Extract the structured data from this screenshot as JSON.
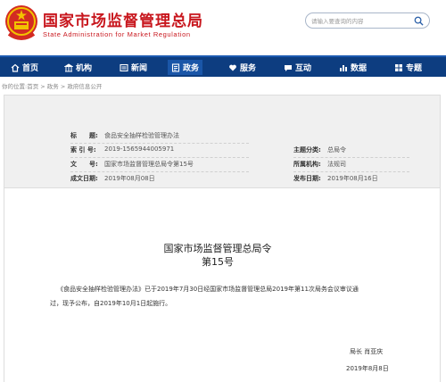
{
  "header": {
    "title": "国家市场监督管理总局",
    "subtitle": "State Administration for Market Regulation",
    "search_placeholder": "请输入要查询的内容"
  },
  "nav": {
    "items": [
      {
        "label": "首页",
        "icon": "home-icon"
      },
      {
        "label": "机构",
        "icon": "building-icon"
      },
      {
        "label": "新闻",
        "icon": "newspaper-icon"
      },
      {
        "label": "政务",
        "icon": "government-icon"
      },
      {
        "label": "服务",
        "icon": "heart-hands-icon"
      },
      {
        "label": "互动",
        "icon": "chat-icon"
      },
      {
        "label": "数据",
        "icon": "bar-chart-icon"
      },
      {
        "label": "专题",
        "icon": "grid-icon"
      }
    ]
  },
  "breadcrumb": {
    "prefix": "你的位置:",
    "home": "首页",
    "sep1": " > ",
    "section": "政务",
    "sep2": " > ",
    "current": "政府信息公开"
  },
  "meta": {
    "title_label": "标　　题:",
    "title_value": "食品安全抽样检验管理办法",
    "index_label": "索 引 号:",
    "index_value": "2019-1565944005971",
    "category_label": "主题分类:",
    "category_value": "总局令",
    "docno_label": "文　　号:",
    "docno_value": "国家市场监督管理总局令第15号",
    "agency_label": "所属机构:",
    "agency_value": "法规司",
    "created_label": "成文日期:",
    "created_value": "2019年08月08日",
    "published_label": "发布日期:",
    "published_value": "2019年08月16日"
  },
  "document": {
    "issuer": "国家市场监督管理总局令",
    "number": "第15号",
    "para1": "《食品安全抽样检验管理办法》已于2019年7月30日经国家市场监督管理总局2019年第11次局务会议审议通",
    "para2": "过，现予公布，自2019年10月1日起施行。",
    "signer": "局长  肖亚庆",
    "date": "2019年8月8日"
  },
  "colors": {
    "brand_red": "#c8161d",
    "nav_blue": "#0d3d80",
    "meta_bg": "#f0f0f0"
  }
}
